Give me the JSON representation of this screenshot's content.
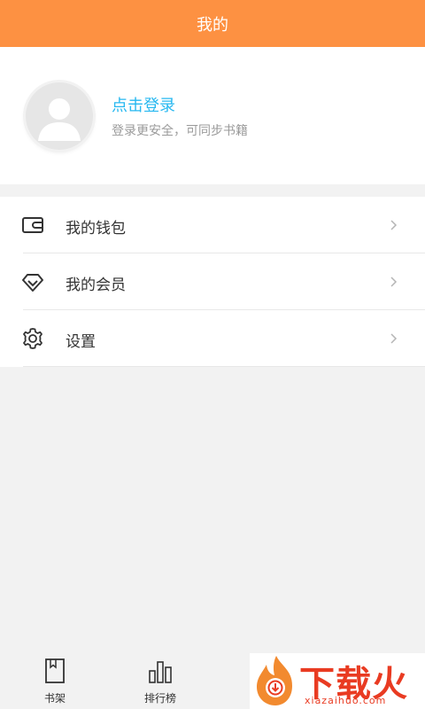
{
  "header": {
    "title": "我的"
  },
  "profile": {
    "login_label": "点击登录",
    "login_subtitle": "登录更安全，可同步书籍"
  },
  "menu": {
    "items": [
      {
        "label": "我的钱包",
        "icon": "wallet-icon"
      },
      {
        "label": "我的会员",
        "icon": "diamond-icon"
      },
      {
        "label": "设置",
        "icon": "gear-icon"
      }
    ]
  },
  "bottom_nav": {
    "items": [
      {
        "label": "书架",
        "icon": "bookshelf-icon"
      },
      {
        "label": "排行榜",
        "icon": "ranking-icon"
      }
    ]
  },
  "watermark": {
    "text": "下载火",
    "site": "xiazaihuo.com"
  },
  "colors": {
    "header_bg": "#fd9142",
    "link": "#27b8f0",
    "watermark": "#e93b22"
  }
}
